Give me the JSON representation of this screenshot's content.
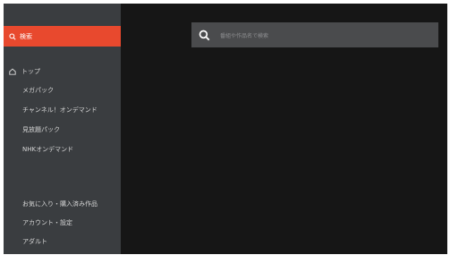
{
  "sidebar": {
    "active_item": {
      "label": "検索",
      "icon": "search-icon"
    },
    "items": [
      {
        "label": "トップ",
        "icon": "home-icon"
      },
      {
        "label": "メガパック"
      },
      {
        "label": "チャンネル！オンデマンド"
      },
      {
        "label": "見放題パック"
      },
      {
        "label": "NHKオンデマンド"
      },
      {
        "label": "お気に入り・購入済み作品"
      },
      {
        "label": "アカウント・設定"
      },
      {
        "label": "アダルト"
      }
    ]
  },
  "search": {
    "placeholder": "番組や作品名で検索",
    "icon": "search-icon"
  },
  "colors": {
    "accent": "#e8492e",
    "sidebar_bg": "#3a3d40",
    "main_bg": "#161616",
    "search_bg": "#4a4b4d"
  }
}
